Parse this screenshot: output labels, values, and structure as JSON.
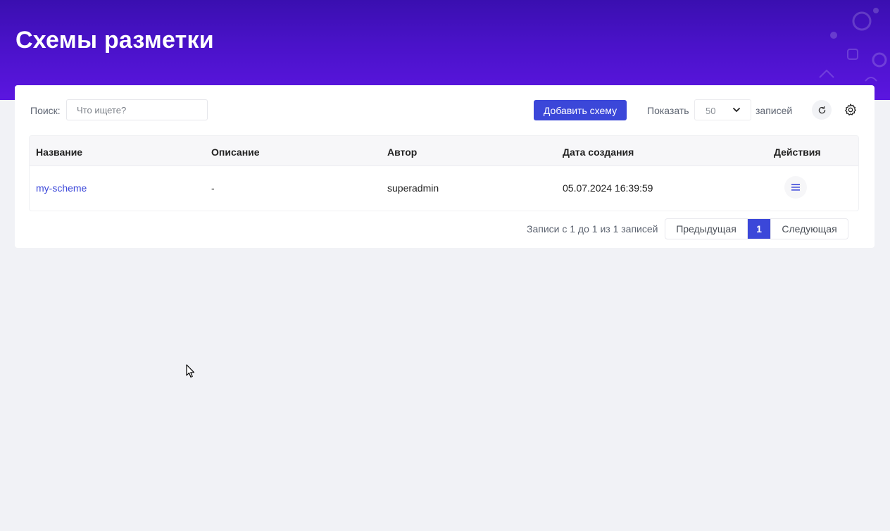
{
  "page": {
    "title": "Схемы разметки"
  },
  "toolbar": {
    "search_label": "Поиск:",
    "search_placeholder": "Что ищете?",
    "search_value": "",
    "add_button": "Добавить схему",
    "show_label": "Показать",
    "page_length": "50",
    "records_label": "записей",
    "refresh_icon": "refresh-icon",
    "settings_icon": "gear-icon"
  },
  "table": {
    "columns": [
      "Название",
      "Описание",
      "Автор",
      "Дата создания",
      "Действия"
    ],
    "rows": [
      {
        "name": "my-scheme",
        "description": "-",
        "author": "superadmin",
        "created": "05.07.2024 16:39:59",
        "actions_icon": "menu-icon"
      }
    ]
  },
  "footer": {
    "info": "Записи с 1 до 1 из 1 записей",
    "prev": "Предыдущая",
    "current_page": "1",
    "next": "Следующая"
  },
  "colors": {
    "header_gradient_start": "#3a0fb0",
    "header_gradient_end": "#5b16e0",
    "accent": "#3b47d9",
    "background": "#f1f2f6"
  }
}
